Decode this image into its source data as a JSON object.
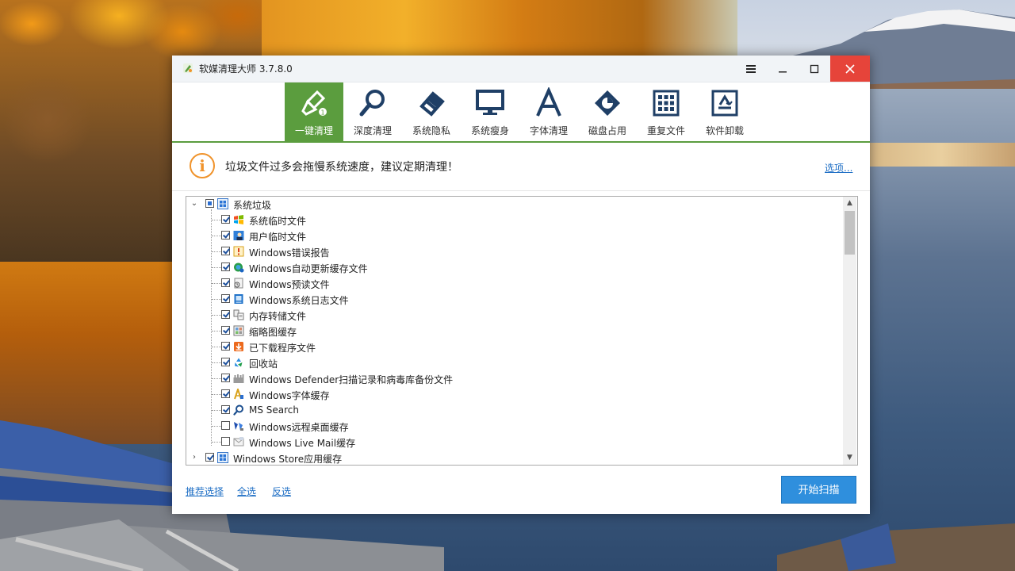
{
  "window": {
    "title": "软媒清理大师 3.7.8.0",
    "menu_icon": "hamburger-icon",
    "minimize_icon": "minimize-icon",
    "maximize_icon": "maximize-icon",
    "close_icon": "close-icon"
  },
  "toolbar": {
    "items": [
      {
        "label": "一键清理",
        "icon": "broom-icon",
        "active": true
      },
      {
        "label": "深度清理",
        "icon": "magnifier-icon"
      },
      {
        "label": "系统隐私",
        "icon": "eraser-icon"
      },
      {
        "label": "系统瘦身",
        "icon": "monitor-icon"
      },
      {
        "label": "字体清理",
        "icon": "font-a-icon"
      },
      {
        "label": "磁盘占用",
        "icon": "disk-pie-icon"
      },
      {
        "label": "重复文件",
        "icon": "grid-icon"
      },
      {
        "label": "软件卸载",
        "icon": "recycle-icon"
      }
    ],
    "accent": "#5b9d3e"
  },
  "info": {
    "icon": "info-icon",
    "message": "垃圾文件过多会拖慢系统速度，建议定期清理！",
    "options_link": "选项..."
  },
  "tree": {
    "groups": [
      {
        "label": "系统垃圾",
        "expanded": true,
        "state": "partial",
        "children": [
          {
            "label": "系统临时文件",
            "checked": true,
            "icon": "windows-flag-icon"
          },
          {
            "label": "用户临时文件",
            "checked": true,
            "icon": "user-icon"
          },
          {
            "label": "Windows错误报告",
            "checked": true,
            "icon": "warning-icon"
          },
          {
            "label": "Windows自动更新缓存文件",
            "checked": true,
            "icon": "globe-update-icon"
          },
          {
            "label": "Windows预读文件",
            "checked": true,
            "icon": "prefetch-icon"
          },
          {
            "label": "Windows系统日志文件",
            "checked": true,
            "icon": "log-icon"
          },
          {
            "label": "内存转储文件",
            "checked": true,
            "icon": "memory-dump-icon"
          },
          {
            "label": "缩略图缓存",
            "checked": true,
            "icon": "thumbnail-icon"
          },
          {
            "label": "已下载程序文件",
            "checked": true,
            "icon": "download-icon"
          },
          {
            "label": "回收站",
            "checked": true,
            "icon": "recycle-bin-icon"
          },
          {
            "label": "Windows Defender扫描记录和病毒库备份文件",
            "checked": true,
            "icon": "defender-icon"
          },
          {
            "label": "Windows字体缓存",
            "checked": true,
            "icon": "font-cache-icon"
          },
          {
            "label": "MS Search",
            "checked": true,
            "icon": "search-icon"
          },
          {
            "label": "Windows远程桌面缓存",
            "checked": false,
            "icon": "remote-desktop-icon"
          },
          {
            "label": "Windows Live Mail缓存",
            "checked": false,
            "icon": "mail-icon"
          }
        ]
      },
      {
        "label": "Windows Store应用缓存",
        "expanded": false,
        "state": "checked",
        "children": []
      }
    ]
  },
  "footer": {
    "recommend_link": "推荐选择",
    "select_all_link": "全选",
    "invert_link": "反选",
    "scan_button": "开始扫描"
  }
}
